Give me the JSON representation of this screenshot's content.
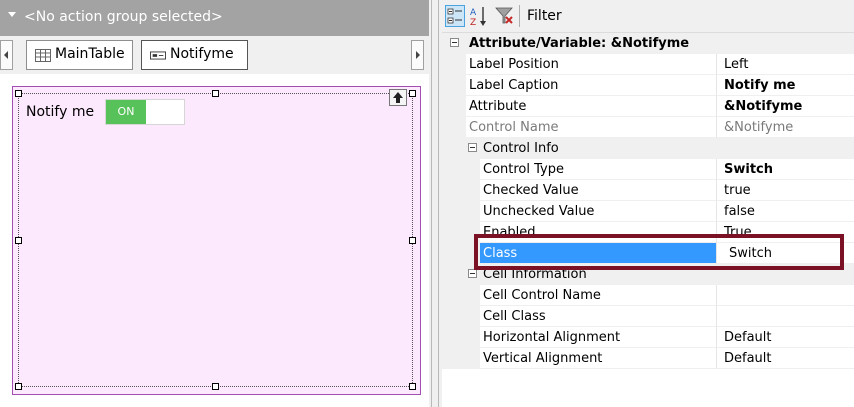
{
  "designer": {
    "action_group_text": "<No action group selected>",
    "tabs": [
      {
        "label": "MainTable",
        "icon": "table-icon"
      },
      {
        "label": "Notifyme",
        "icon": "control-icon"
      }
    ],
    "switch_label": "Notify me",
    "switch_state": "ON",
    "switch_color": "#57c15a",
    "canvas_bg": "#fde9fd",
    "canvas_border": "#a24fb2"
  },
  "properties": {
    "toolbar": {
      "filter_label": "Filter",
      "icons": [
        "categorized-icon",
        "sort-alpha-icon",
        "filter-icon"
      ]
    },
    "header": "Attribute/Variable: &Notifyme",
    "rows_top": [
      {
        "name": "Label Position",
        "value": "Left",
        "bold": false,
        "grey": false
      },
      {
        "name": "Label Caption",
        "value": "Notify me",
        "bold": true,
        "grey": false
      },
      {
        "name": "Attribute",
        "value": "&Notifyme",
        "bold": true,
        "grey": false
      },
      {
        "name": "Control Name",
        "value": "&Notifyme",
        "bold": false,
        "grey": true
      }
    ],
    "control_info": {
      "title": "Control Info",
      "rows": [
        {
          "name": "Control Type",
          "value": "Switch",
          "bold": true
        },
        {
          "name": "Checked Value",
          "value": "true",
          "bold": false
        },
        {
          "name": "Unchecked Value",
          "value": "false",
          "bold": false
        },
        {
          "name": "Enabled",
          "value": "True",
          "bold": false
        },
        {
          "name": "Class",
          "value": "Switch",
          "bold": false,
          "selected": true
        }
      ]
    },
    "cell_information": {
      "title": "Cell Information",
      "rows": [
        {
          "name": "Cell Control Name",
          "value": ""
        },
        {
          "name": "Cell Class",
          "value": ""
        },
        {
          "name": "Horizontal Alignment",
          "value": "Default"
        },
        {
          "name": "Vertical Alignment",
          "value": "Default"
        }
      ]
    },
    "selection_color": "#3399ff",
    "highlight_color": "#7b1124"
  }
}
